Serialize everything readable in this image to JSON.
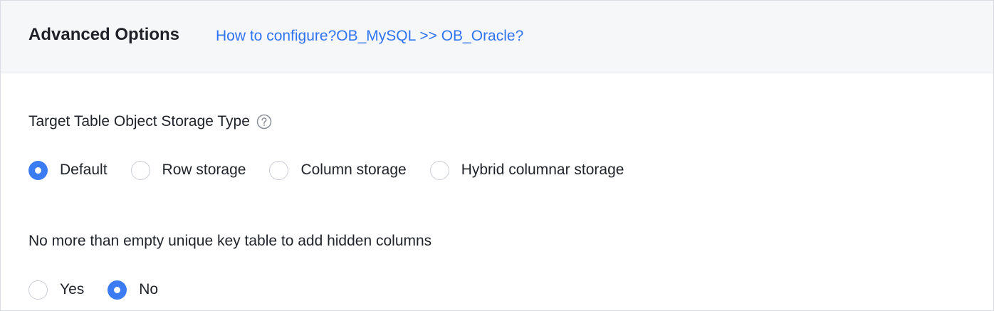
{
  "header": {
    "title": "Advanced Options",
    "link": "How to configure?OB_MySQL >> OB_Oracle?"
  },
  "storage_type": {
    "label": "Target Table Object Storage Type",
    "help_icon": "question-circle-icon",
    "options": [
      {
        "label": "Default",
        "checked": true
      },
      {
        "label": "Row storage",
        "checked": false
      },
      {
        "label": "Column storage",
        "checked": false
      },
      {
        "label": "Hybrid columnar storage",
        "checked": false
      }
    ]
  },
  "hidden_columns": {
    "label": "No more than empty unique key table to add hidden columns",
    "options": [
      {
        "label": "Yes",
        "checked": false
      },
      {
        "label": "No",
        "checked": true
      }
    ]
  },
  "colors": {
    "accent": "#3b7cf2",
    "link": "#2f74f0",
    "header_bg": "#f6f7f9",
    "border": "#d9dde3"
  }
}
